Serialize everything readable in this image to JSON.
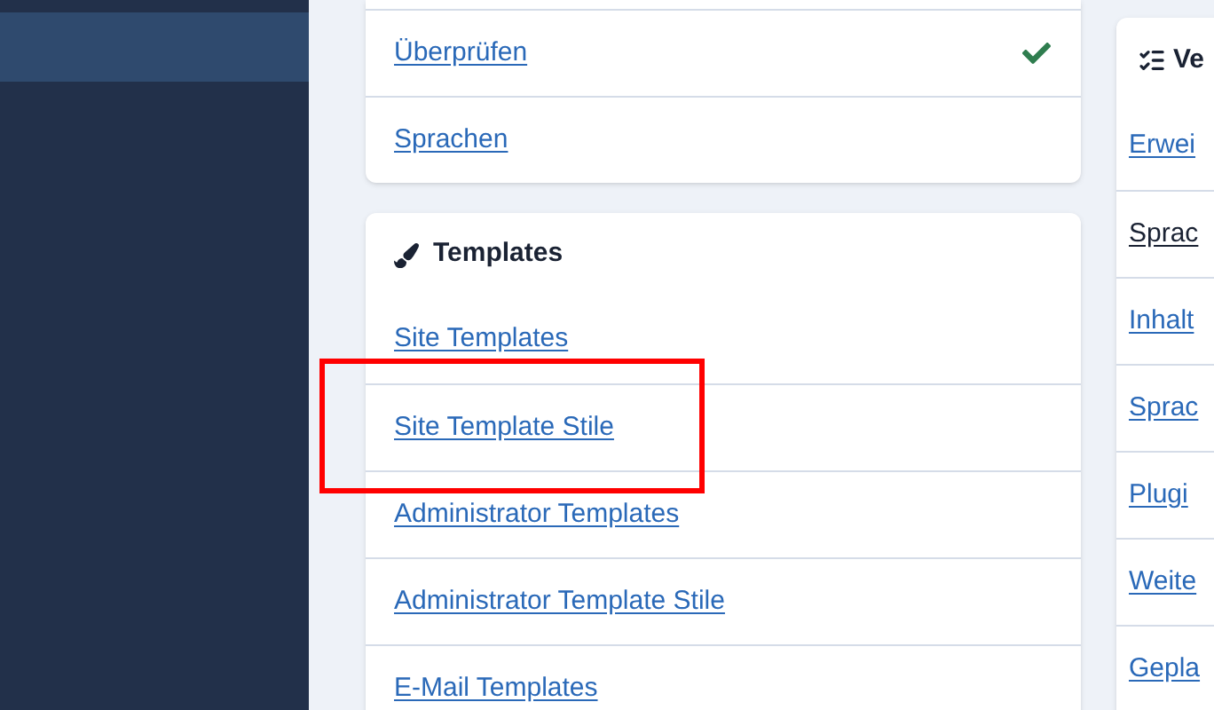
{
  "card_1": {
    "items": [
      {
        "label": "Überprüfen",
        "checked": true
      },
      {
        "label": "Sprachen",
        "checked": false
      }
    ]
  },
  "templates": {
    "title": "Templates",
    "items": [
      {
        "label": "Site Templates"
      },
      {
        "label": "Site Template Stile"
      },
      {
        "label": "Administrator Templates"
      },
      {
        "label": "Administrator Template Stile"
      },
      {
        "label": "E-Mail Templates"
      }
    ]
  },
  "card_3": {
    "title": "Ve",
    "items": [
      {
        "label": "Erwei",
        "visited": false
      },
      {
        "label": "Sprac",
        "visited": true
      },
      {
        "label": "Inhalt",
        "visited": false
      },
      {
        "label": "Sprac",
        "visited": false
      },
      {
        "label": "Plugi",
        "visited": false
      },
      {
        "label": "Weite",
        "visited": false
      },
      {
        "label": "Gepla",
        "visited": false
      }
    ]
  }
}
